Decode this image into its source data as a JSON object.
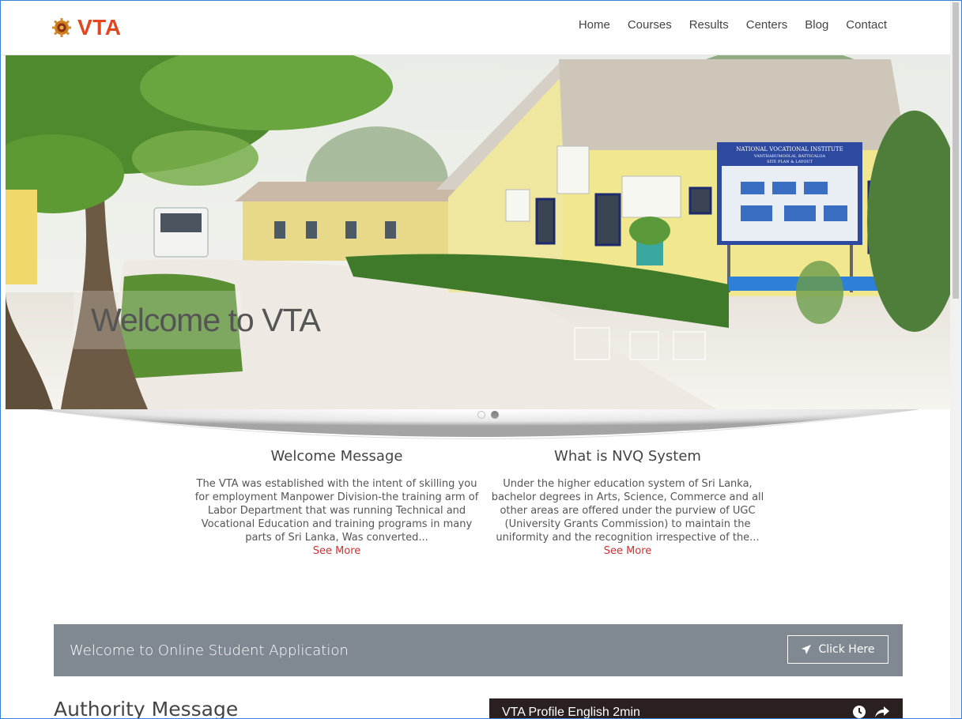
{
  "brand": {
    "name": "VTA",
    "color": "#e2471f"
  },
  "nav": {
    "items": [
      {
        "label": "Home"
      },
      {
        "label": "Courses"
      },
      {
        "label": "Results"
      },
      {
        "label": "Centers"
      },
      {
        "label": "Blog"
      },
      {
        "label": "Contact"
      }
    ]
  },
  "hero": {
    "caption": "Welcome to VTA",
    "signboard": [
      "NATIONAL VOCATIONAL INSTITUTE",
      "VANTHARUMOOLAI, BATTICALOA",
      "SITE PLAN & LAYOUT"
    ],
    "slides_total": 2,
    "active_slide": 2
  },
  "welcome": {
    "title": "Welcome Message",
    "text": "The VTA was established with the intent of skilling you for employment Manpower Division-the training arm of Labor Department that was running Technical and Vocational Education and training programs in many parts of Sri Lanka, Was converted...",
    "more": "See More"
  },
  "nvq": {
    "title": "What is NVQ System",
    "text": "Under the higher education system of Sri Lanka, bachelor degrees in Arts, Science, Commerce and all other areas are offered under the purview of UGC (University Grants Commission) to maintain the uniformity and the recognition irrespective of the...",
    "more": "See More"
  },
  "application": {
    "title": "Welcome to Online Student Application",
    "button": "Click Here",
    "button_icon": "paper-plane-icon"
  },
  "authority": {
    "title": "Authority Message"
  },
  "video": {
    "title": "VTA Profile English 2min",
    "icons": [
      "clock-icon",
      "share-icon"
    ]
  },
  "colors": {
    "accent_red": "#d32f2f",
    "app_bar": "#808892"
  }
}
